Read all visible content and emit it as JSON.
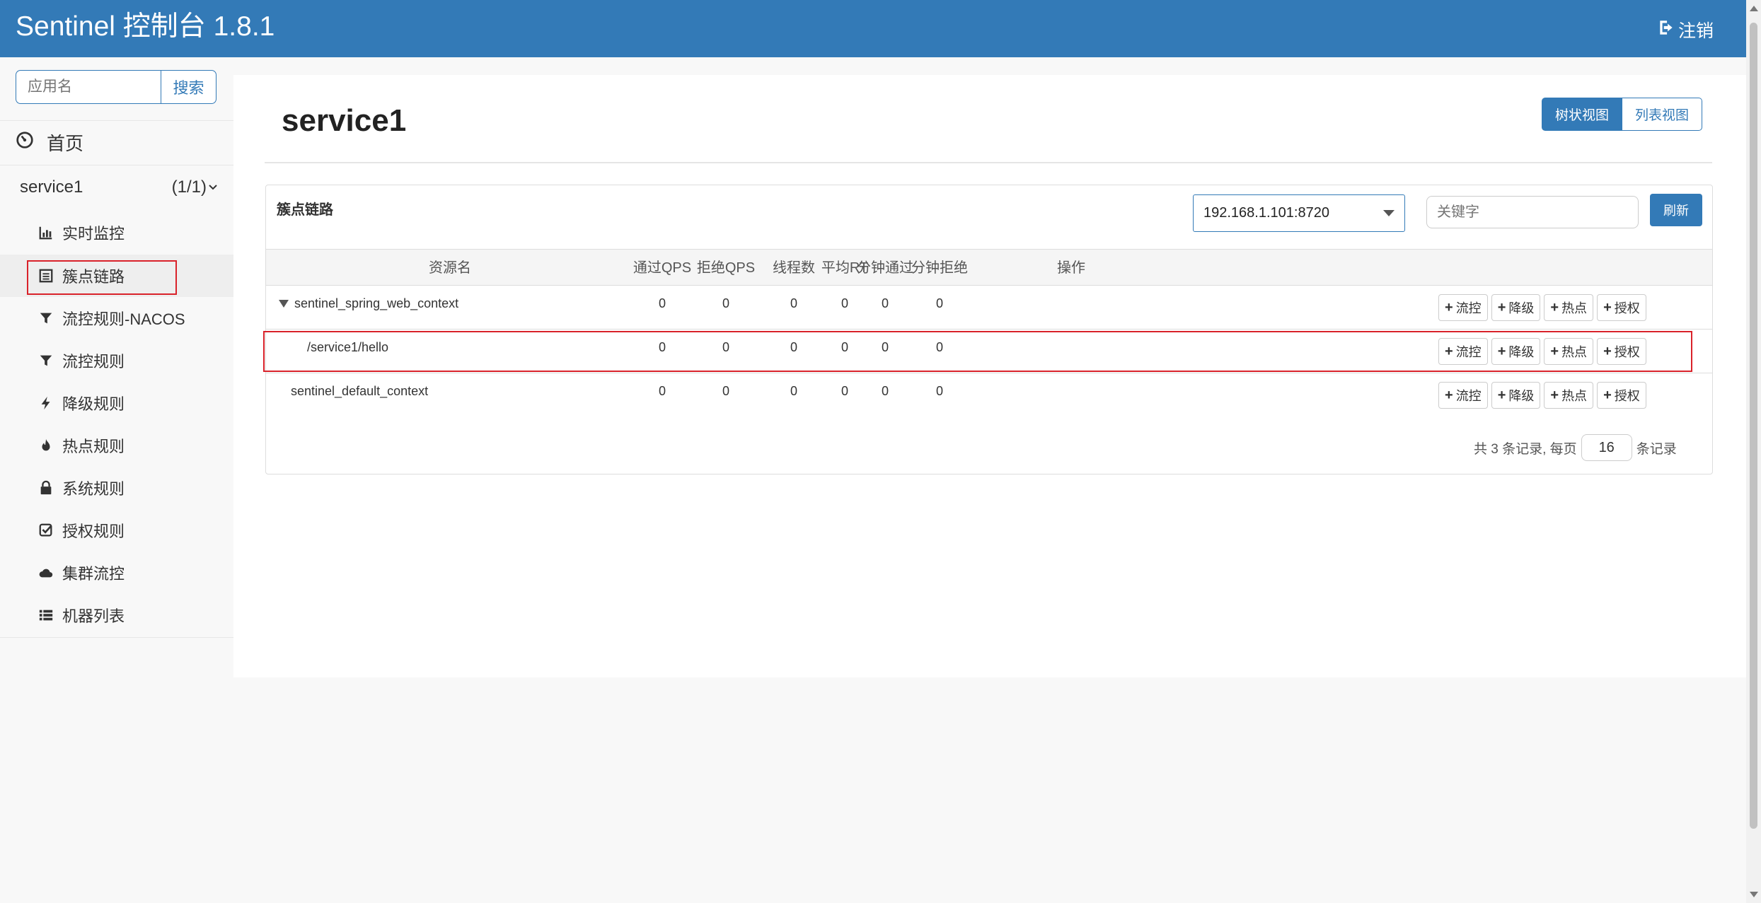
{
  "header": {
    "brand": "Sentinel 控制台 1.8.1",
    "logout_label": "注销",
    "logout_icon": "sign-out-icon",
    "bg_color": "#337ab7"
  },
  "sidebar": {
    "search_placeholder": "应用名",
    "search_button": "搜索",
    "home_label": "首页",
    "app_name": "service1",
    "app_count": "(1/1)",
    "items": [
      {
        "label": "实时监控",
        "icon": "bar-chart-icon"
      },
      {
        "label": "簇点链路",
        "icon": "list-alt-icon",
        "active": true
      },
      {
        "label": "流控规则-NACOS",
        "icon": "filter-icon"
      },
      {
        "label": "流控规则",
        "icon": "filter-icon"
      },
      {
        "label": "降级规则",
        "icon": "flash-icon"
      },
      {
        "label": "热点规则",
        "icon": "fire-icon"
      },
      {
        "label": "系统规则",
        "icon": "lock-icon"
      },
      {
        "label": "授权规则",
        "icon": "check-icon"
      },
      {
        "label": "集群流控",
        "icon": "cloud-icon"
      },
      {
        "label": "机器列表",
        "icon": "list-icon"
      }
    ]
  },
  "main": {
    "title": "service1",
    "view_tree": "树状视图",
    "view_list": "列表视图",
    "panel_title": "簇点链路",
    "machine": "192.168.1.101:8720",
    "keyword_placeholder": "关键字",
    "refresh": "刷新",
    "columns": [
      "资源名",
      "通过QPS",
      "拒绝QPS",
      "线程数",
      "平均RT",
      "分钟通过",
      "分钟拒绝",
      "操作"
    ],
    "rows": [
      {
        "name": "sentinel_spring_web_context",
        "pass_qps": "0",
        "block_qps": "0",
        "threads": "0",
        "avg_rt": "0",
        "min_pass": "0",
        "min_block": "0"
      },
      {
        "name": "/service1/hello",
        "pass_qps": "0",
        "block_qps": "0",
        "threads": "0",
        "avg_rt": "0",
        "min_pass": "0",
        "min_block": "0"
      },
      {
        "name": "sentinel_default_context",
        "pass_qps": "0",
        "block_qps": "0",
        "threads": "0",
        "avg_rt": "0",
        "min_pass": "0",
        "min_block": "0"
      }
    ],
    "actions": [
      "流控",
      "降级",
      "热点",
      "授权"
    ],
    "pager_prefix": "共 3 条记录, 每页",
    "page_size": "16",
    "pager_suffix": "条记录"
  },
  "highlight_color": "#d9222a"
}
